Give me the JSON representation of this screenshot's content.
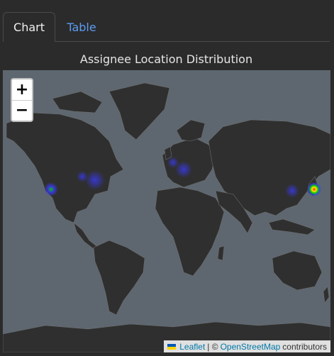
{
  "tabs": {
    "chart_label": "Chart",
    "table_label": "Table"
  },
  "chart_title": "Assignee Location Distribution",
  "zoom": {
    "in_label": "+",
    "out_label": "−"
  },
  "attribution": {
    "leaflet": "Leaflet",
    "separator": "| ©",
    "osm": "OpenStreetMap",
    "contributors": "contributors"
  },
  "colors": {
    "ocean": "#5e6770",
    "land": "#2f2f2f",
    "border": "#6e6e6e",
    "heat_low": "#3a3aff",
    "heat_mid": "#00c800",
    "heat_high": "#ffe000",
    "heat_peak": "#ff2020"
  },
  "heatmap_hotspots": [
    {
      "region": "US West Coast",
      "intensity": "medium"
    },
    {
      "region": "US East",
      "intensity": "low"
    },
    {
      "region": "Europe",
      "intensity": "low"
    },
    {
      "region": "China East",
      "intensity": "low"
    },
    {
      "region": "Japan",
      "intensity": "high"
    }
  ]
}
